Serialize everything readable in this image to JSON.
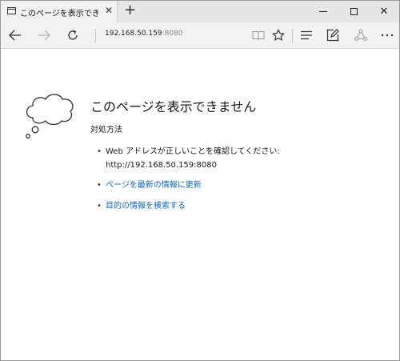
{
  "tab": {
    "title": "このページを表示できません",
    "close_glyph": "✕"
  },
  "titlebar": {
    "new_tab_glyph": "+",
    "close_glyph": "✕"
  },
  "address": {
    "host": "192.168.50.159",
    "port": ":8080"
  },
  "page": {
    "title": "このページを表示できません",
    "subtitle": "対処方法",
    "bullet": "•",
    "items": [
      {
        "text": "Web アドレスが正しいことを確認してください:",
        "detail": "http://192.168.50.159:8080"
      },
      {
        "text": "ページを最新の情報に更新"
      },
      {
        "text": "目的の情報を検索する"
      }
    ]
  },
  "colors": {
    "link": "#0a66c9",
    "chrome": "#f2f2f2",
    "titlebar": "#e6e6e6"
  }
}
